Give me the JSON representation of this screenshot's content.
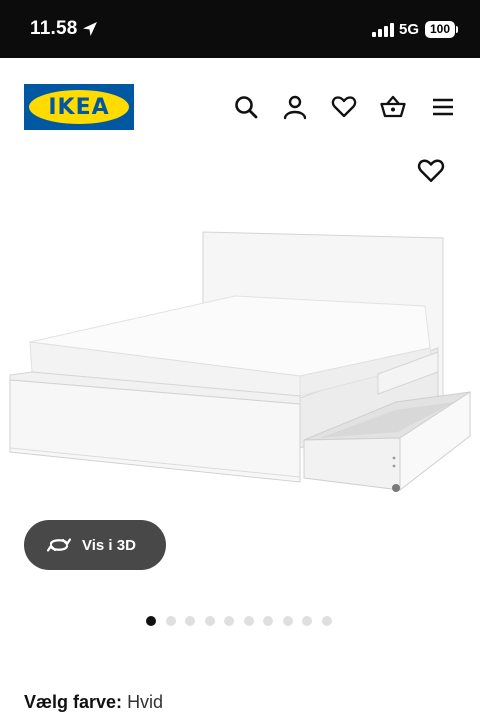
{
  "status_bar": {
    "time": "11.58",
    "network": "5G",
    "battery": "100"
  },
  "header": {
    "logo_text": "IKEA",
    "icons": [
      "search-icon",
      "profile-icon",
      "heart-icon",
      "basket-icon",
      "menu-icon"
    ]
  },
  "product": {
    "image_subject": "white bed frame with drawers",
    "favorite_icon": "heart-icon",
    "view3d_label": "Vis i 3D",
    "pagination": {
      "total": 10,
      "current": 1
    },
    "color_label": "Vælg farve:",
    "color_value": "Hvid"
  },
  "colors": {
    "ikea_blue": "#0058a3",
    "ikea_yellow": "#ffdb00",
    "status_bar_bg": "#0c0c0c",
    "button_bg": "#484848",
    "dot_inactive": "#dfdfdf",
    "dot_active": "#111111"
  }
}
